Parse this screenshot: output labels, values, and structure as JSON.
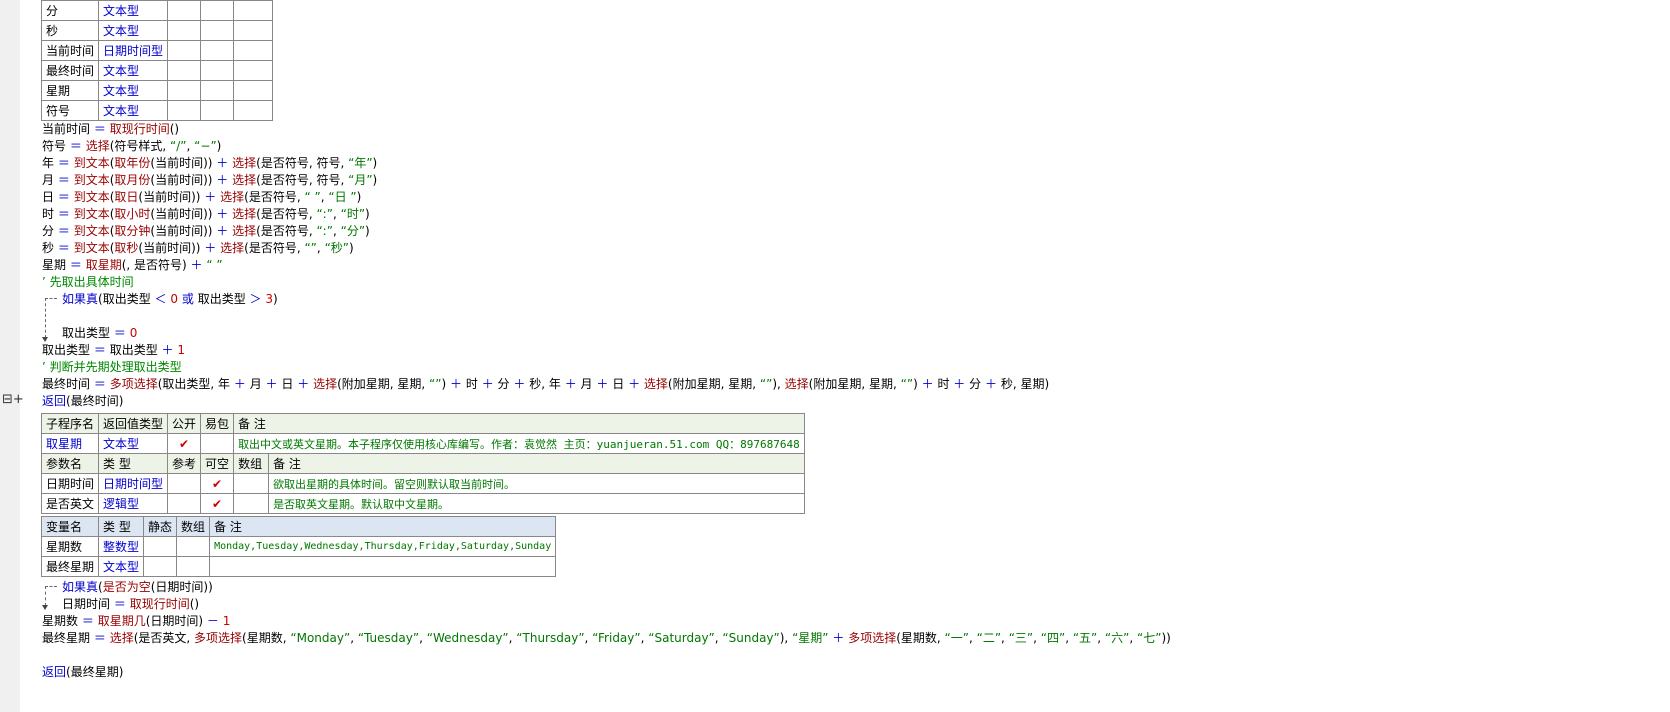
{
  "var_table_top": {
    "rows": [
      {
        "name": "分",
        "type": "文本型"
      },
      {
        "name": "秒",
        "type": "文本型"
      },
      {
        "name": "当前时间",
        "type": "日期时间型"
      },
      {
        "name": "最终时间",
        "type": "文本型"
      },
      {
        "name": "星期",
        "type": "文本型"
      },
      {
        "name": "符号",
        "type": "文本型"
      }
    ]
  },
  "code1": {
    "l1": {
      "a": "当前时间",
      "op": "＝",
      "fn": "取现行时间",
      "b": "()"
    },
    "l2": {
      "a": "符号",
      "op": "＝",
      "fn": "选择",
      "b": "(符号样式,",
      "s1": "“/”",
      "c": ",",
      "s2": "“−”",
      "d": ")"
    },
    "l3": {
      "a": "年",
      "op": "＝",
      "fn": "到文本",
      "b": "(",
      "fn2": "取年份",
      "c": "(当前时间))",
      "plus": "＋",
      "fn3": "选择",
      "d": "(是否符号, 符号,",
      "s": "“年”",
      "e": ")"
    },
    "l4": {
      "a": "月",
      "op": "＝",
      "fn": "到文本",
      "b": "(",
      "fn2": "取月份",
      "c": "(当前时间))",
      "plus": "＋",
      "fn3": "选择",
      "d": "(是否符号, 符号,",
      "s": "“月”",
      "e": ")"
    },
    "l5": {
      "a": "日",
      "op": "＝",
      "fn": "到文本",
      "b": "(",
      "fn2": "取日",
      "c": "(当前时间))",
      "plus": "＋",
      "fn3": "选择",
      "d": "(是否符号,",
      "s1": "“ ”",
      "c2": ",",
      "s": "“日 ”",
      "e": ")"
    },
    "l6": {
      "a": "时",
      "op": "＝",
      "fn": "到文本",
      "b": "(",
      "fn2": "取小时",
      "c": "(当前时间))",
      "plus": "＋",
      "fn3": "选择",
      "d": "(是否符号,",
      "s1": "“:”",
      "c2": ",",
      "s": "“时”",
      "e": ")"
    },
    "l7": {
      "a": "分",
      "op": "＝",
      "fn": "到文本",
      "b": "(",
      "fn2": "取分钟",
      "c": "(当前时间))",
      "plus": "＋",
      "fn3": "选择",
      "d": "(是否符号,",
      "s1": "“:”",
      "c2": ",",
      "s": "“分”",
      "e": ")"
    },
    "l8": {
      "a": "秒",
      "op": "＝",
      "fn": "到文本",
      "b": "(",
      "fn2": "取秒",
      "c": "(当前时间))",
      "plus": "＋",
      "fn3": "选择",
      "d": "(是否符号,",
      "s1": "“”",
      "c2": ",",
      "s": "“秒”",
      "e": ")"
    },
    "l9": {
      "a": "星期",
      "op": "＝",
      "fn": "取星期",
      "b": "(, 是否符号)",
      "plus": "＋",
      "s": "“ ”"
    },
    "c1": "’ 先取出具体时间",
    "l10": {
      "kw": "如果真",
      "b": "(取出类型",
      "lt": "＜",
      "n0": "0",
      "or": "或",
      "c": "取出类型",
      "gt": "＞",
      "n3": "3",
      "e": ")"
    },
    "l11": {
      "a": "取出类型",
      "op": "＝",
      "n": "0"
    },
    "l12": {
      "a": "取出类型",
      "op": "＝",
      "b": "取出类型",
      "plus": "＋",
      "n": "1"
    },
    "c2": "’ 判断并先期处理取出类型",
    "l13": {
      "a": "最终时间",
      "op": "＝",
      "fn": "多项选择",
      "b": "(取出类型, 年",
      "p": "＋",
      "m": "月",
      "d": "日",
      "fn2": "选择",
      "x": "(附加星期, 星期,",
      "s": "“”",
      "c": ")",
      "h": "时",
      "mi": "分",
      "se": "秒",
      "y": "秒, 年",
      "t": "星期)"
    },
    "l14": {
      "kw": "返回",
      "b": "(最终时间)"
    }
  },
  "sub_table": {
    "headers": [
      "子程序名",
      "返回值类型",
      "公开",
      "易包",
      "备 注"
    ],
    "row": {
      "name": "取星期",
      "type": "文本型",
      "note": "取出中文或英文星期。本子程序仅使用核心库编写。作者：袁觉然 主页：yuanjueran.51.com QQ：897687648"
    },
    "param_headers": [
      "参数名",
      "类 型",
      "参考",
      "可空",
      "数组",
      "备 注"
    ],
    "params": [
      {
        "name": "日期时间",
        "type": "日期时间型",
        "note": "欲取出星期的具体时间。留空则默认取当前时间。"
      },
      {
        "name": "是否英文",
        "type": "逻辑型",
        "note": "是否取英文星期。默认取中文星期。"
      }
    ]
  },
  "local_table": {
    "headers": [
      "变量名",
      "类 型",
      "静态",
      "数组",
      "备 注"
    ],
    "rows": [
      {
        "name": "星期数",
        "type": "整数型",
        "note": "Monday,Tuesday,Wednesday,Thursday,Friday,Saturday,Sunday"
      },
      {
        "name": "最终星期",
        "type": "文本型",
        "note": ""
      }
    ]
  },
  "code2": {
    "l1": {
      "kw": "如果真",
      "b": "(",
      "fn": "是否为空",
      "c": "(日期时间))"
    },
    "l2": {
      "a": "日期时间",
      "op": "＝",
      "fn": "取现行时间",
      "b": "()"
    },
    "l3": {
      "a": "星期数",
      "op": "＝",
      "fn": "取星期几",
      "b": "(日期时间)",
      "minus": "－",
      "n": "1"
    },
    "l4": {
      "a": "最终星期",
      "op": "＝",
      "fn": "选择",
      "b": "(是否英文,",
      "fn2": "多项选择",
      "c": "(星期数,",
      "s": [
        "“Monday”",
        "“Tuesday”",
        "“Wednesday”",
        "“Thursday”",
        "“Friday”",
        "“Saturday”",
        "“Sunday”"
      ],
      "d": "),",
      "s2": "“星期”",
      "plus": "＋",
      "fn3": "多项选择",
      "e": "(星期数,",
      "cn": [
        "“一”",
        "“二”",
        "“三”",
        "“四”",
        "“五”",
        "“六”",
        "“七”"
      ],
      "f": "))"
    },
    "l5": {
      "kw": "返回",
      "b": "(最终星期)"
    }
  },
  "check": "✔",
  "margin_icon": "⊟+"
}
